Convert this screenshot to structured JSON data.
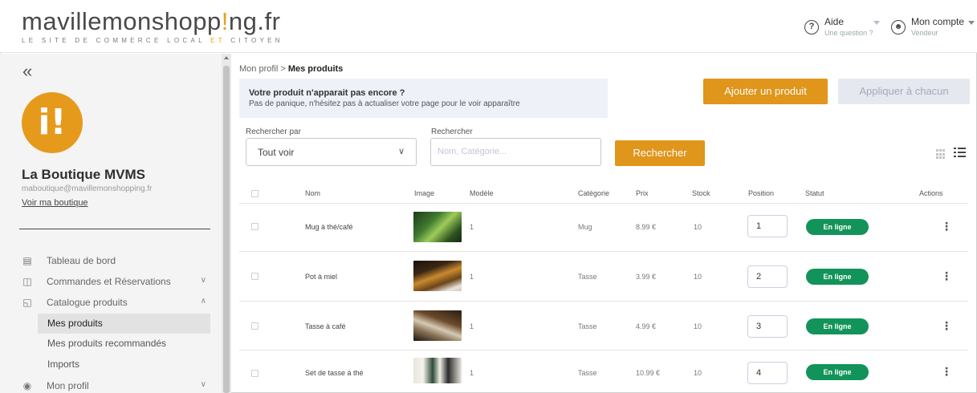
{
  "header": {
    "logo_part1": "mavillemonshopp",
    "logo_accent": "!",
    "logo_part2": "ng.fr",
    "tagline_part1": "LE SITE DE COMMERCE LOCAL ",
    "tagline_accent": "ET",
    "tagline_part2": " CITOYEN",
    "help_title": "Aide",
    "help_sub": "Une question ?",
    "account_title": "Mon compte",
    "account_sub": "Vendeur"
  },
  "sidebar": {
    "collapse_glyph": "«",
    "avatar_text": "i!",
    "shop_name": "La Boutique MVMS",
    "shop_email": "maboutique@mavillemonshopping.fr",
    "shop_link": "Voir ma boutique",
    "nav": [
      {
        "label": "Tableau de bord",
        "icon": "dashboard-icon"
      },
      {
        "label": "Commandes et Réservations",
        "icon": "cart-icon"
      },
      {
        "label": "Catalogue produits",
        "icon": "bag-icon"
      },
      {
        "label": "Mon profil",
        "icon": "profile-icon"
      }
    ],
    "subnav": [
      {
        "label": "Mes produits",
        "active": true
      },
      {
        "label": "Mes produits recommandés",
        "active": false
      },
      {
        "label": "Imports",
        "active": false
      }
    ]
  },
  "breadcrumb": {
    "parent": "Mon profil",
    "separator": " > ",
    "current": "Mes produits"
  },
  "info": {
    "title": "Votre produit n'apparait pas encore ?",
    "text": "Pas de panique, n'hésitez pas à actualiser votre page pour le voir apparaître"
  },
  "actions": {
    "add": "Ajouter un produit",
    "apply": "Appliquer à chacun"
  },
  "filters": {
    "search_by_label": "Rechercher par",
    "search_by_value": "Tout voir",
    "search_label": "Rechercher",
    "search_placeholder": "Nom, Catégorie...",
    "search_button": "Rechercher"
  },
  "table": {
    "headers": {
      "name": "Nom",
      "image": "Image",
      "model": "Modèle",
      "category": "Catégorie",
      "price": "Prix",
      "stock": "Stock",
      "position": "Position",
      "status": "Statut",
      "actions": "Actions"
    },
    "rows": [
      {
        "name": "Mug à thé/café",
        "model": "1",
        "category": "Mug",
        "price": "8.99 €",
        "stock": "10",
        "position": "1",
        "status": "En ligne"
      },
      {
        "name": "Pot à miel",
        "model": "1",
        "category": "Tasse",
        "price": "3.99 €",
        "stock": "10",
        "position": "2",
        "status": "En ligne"
      },
      {
        "name": "Tasse à café",
        "model": "1",
        "category": "Tasse",
        "price": "4.99 €",
        "stock": "10",
        "position": "3",
        "status": "En ligne"
      },
      {
        "name": "Set de tasse à thé",
        "model": "1",
        "category": "Tasse",
        "price": "10.99 €",
        "stock": "10",
        "position": "4",
        "status": "En ligne"
      }
    ]
  },
  "colors": {
    "accent": "#e0951b",
    "status_online": "#12935a"
  }
}
